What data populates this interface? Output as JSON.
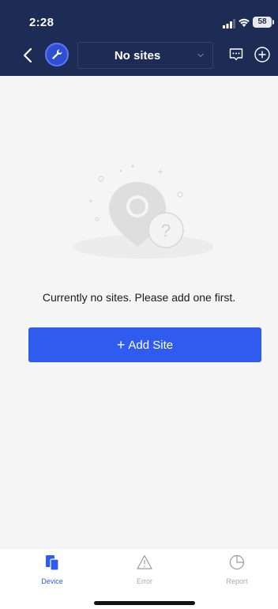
{
  "status_bar": {
    "time": "2:28",
    "battery": "58"
  },
  "nav": {
    "site_select": "No sites",
    "icons": [
      "back-icon",
      "wrench-icon",
      "chevron-down-icon",
      "message-icon",
      "add-circle-icon"
    ]
  },
  "empty_state": {
    "message": "Currently no sites. Please add one first.",
    "add_button_label": "Add Site",
    "illustration": "location-pin-question-icon"
  },
  "tabs": [
    {
      "label": "Device",
      "icon": "device-icon",
      "active": true
    },
    {
      "label": "Error",
      "icon": "warning-icon",
      "active": false
    },
    {
      "label": "Report",
      "icon": "pie-chart-icon",
      "active": false
    }
  ],
  "colors": {
    "header_bg": "#1d2c55",
    "accent": "#2f5bef",
    "page_bg": "#f5f5f5",
    "inactive_tab": "#aaaaaa"
  }
}
